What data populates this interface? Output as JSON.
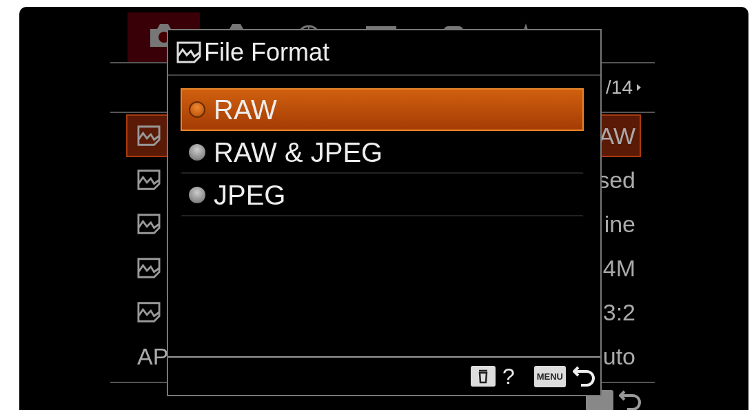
{
  "menu_tabs": [
    {
      "kind": "camera",
      "selected": true
    },
    {
      "kind": "camera",
      "selected": false
    },
    {
      "kind": "globe",
      "selected": false
    },
    {
      "kind": "display",
      "selected": false
    },
    {
      "kind": "case",
      "selected": false
    },
    {
      "kind": "star",
      "selected": false
    }
  ],
  "page_indicator": "/14",
  "menu_rows": [
    {
      "kind": "icon",
      "value": "AW",
      "selected": true
    },
    {
      "kind": "icon",
      "value": "sed",
      "selected": false
    },
    {
      "kind": "icon",
      "value": "ine",
      "selected": false
    },
    {
      "kind": "icon",
      "value": "4M",
      "selected": false
    },
    {
      "kind": "icon",
      "value": "3:2",
      "selected": false
    },
    {
      "kind": "text",
      "label": "AP",
      "value": "uto",
      "selected": false
    }
  ],
  "dialog": {
    "title": "File Format",
    "options": [
      {
        "label": "RAW",
        "selected": true
      },
      {
        "label": "RAW & JPEG",
        "selected": false
      },
      {
        "label": "JPEG",
        "selected": false
      }
    ],
    "footer": {
      "help": "?",
      "menu_key": "MENU"
    }
  }
}
